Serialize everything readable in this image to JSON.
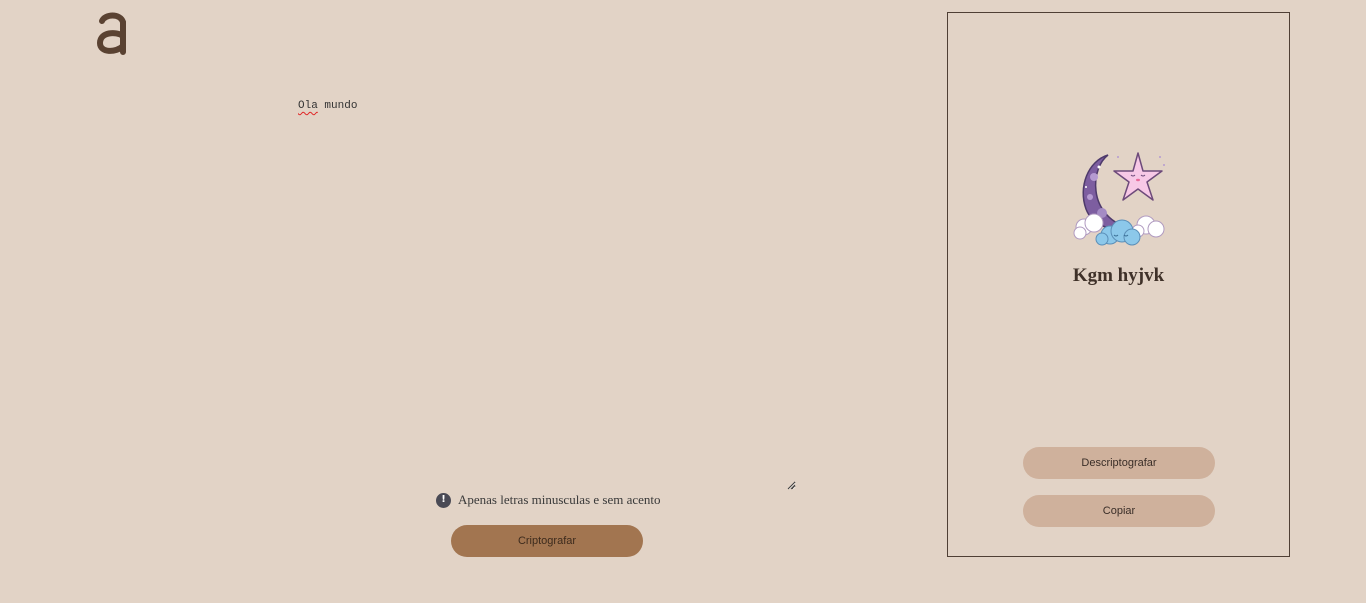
{
  "logo": {
    "icon": "alura-logo-icon",
    "color": "#5a4232"
  },
  "input": {
    "first_word": "Ola",
    "rest": " mundo",
    "value": "Ola mundo"
  },
  "hint": {
    "icon": "exclamation-circle-icon",
    "text": "Apenas letras minusculas e sem acento"
  },
  "encrypt_button": {
    "label": "Criptografar"
  },
  "output_panel": {
    "illustration": "moon-star-cloud-illustration",
    "result_text": "Kgm hyjvk",
    "decrypt_button": {
      "label": "Descriptografar"
    },
    "copy_button": {
      "label": "Copiar"
    }
  },
  "colors": {
    "background": "#e2d3c6",
    "primary_button": "#a27550",
    "secondary_button": "#cfb19c",
    "panel_border": "#4f3f35"
  }
}
